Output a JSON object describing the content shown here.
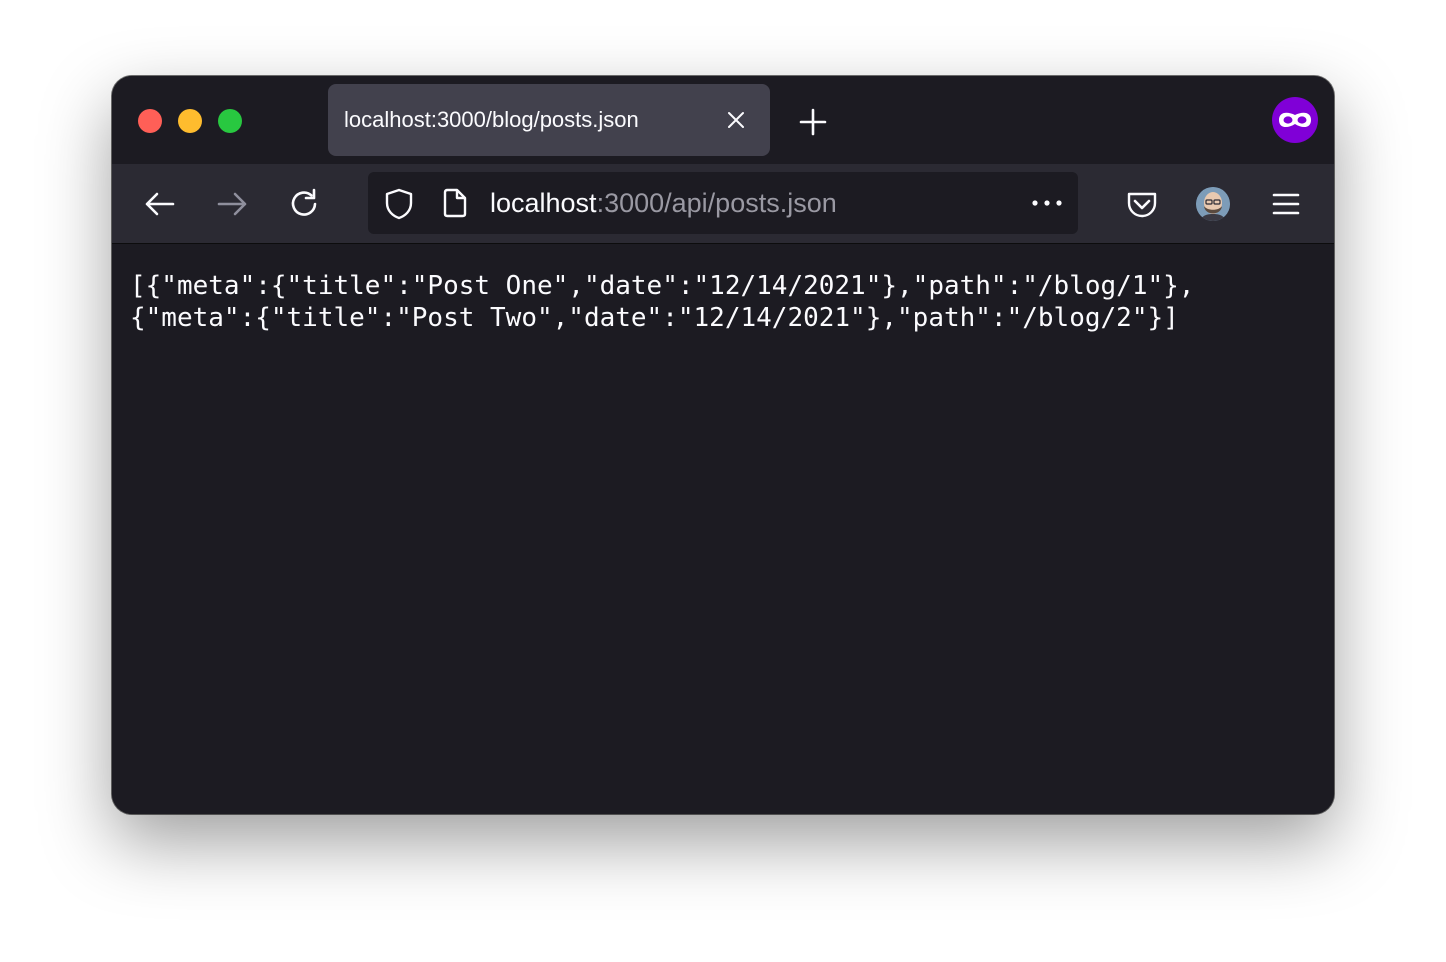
{
  "window": {
    "traffic_lights": {
      "close_color": "#ff5f57",
      "minimize_color": "#febc2e",
      "maximize_color": "#28c840"
    }
  },
  "tab": {
    "title": "localhost:3000/blog/posts.json",
    "close_icon": "close-icon"
  },
  "toolbar": {
    "new_tab_icon": "plus-icon",
    "private_browsing_icon": "private-mask-icon",
    "back_icon": "arrow-left-icon",
    "forward_icon": "arrow-right-icon",
    "reload_icon": "reload-icon",
    "pocket_icon": "pocket-icon",
    "account_icon": "avatar",
    "menu_icon": "hamburger-menu-icon"
  },
  "urlbar": {
    "host": "localhost",
    "rest": ":3000/api/posts.json",
    "tracking_protection_icon": "shield-icon",
    "page_info_icon": "page-icon",
    "page_actions_icon": "more-dots-icon"
  },
  "content": {
    "raw_json": "[{\"meta\":{\"title\":\"Post One\",\"date\":\"12/14/2021\"},\"path\":\"/blog/1\"},\n{\"meta\":{\"title\":\"Post Two\",\"date\":\"12/14/2021\"},\"path\":\"/blog/2\"}]"
  },
  "colors": {
    "chrome_dark": "#1c1b22",
    "toolbar": "#2b2a33",
    "tab_selected": "#42414d",
    "private_purple": "#8000d7",
    "text": "#fbfbfe",
    "text_dim": "#9a99a3"
  }
}
